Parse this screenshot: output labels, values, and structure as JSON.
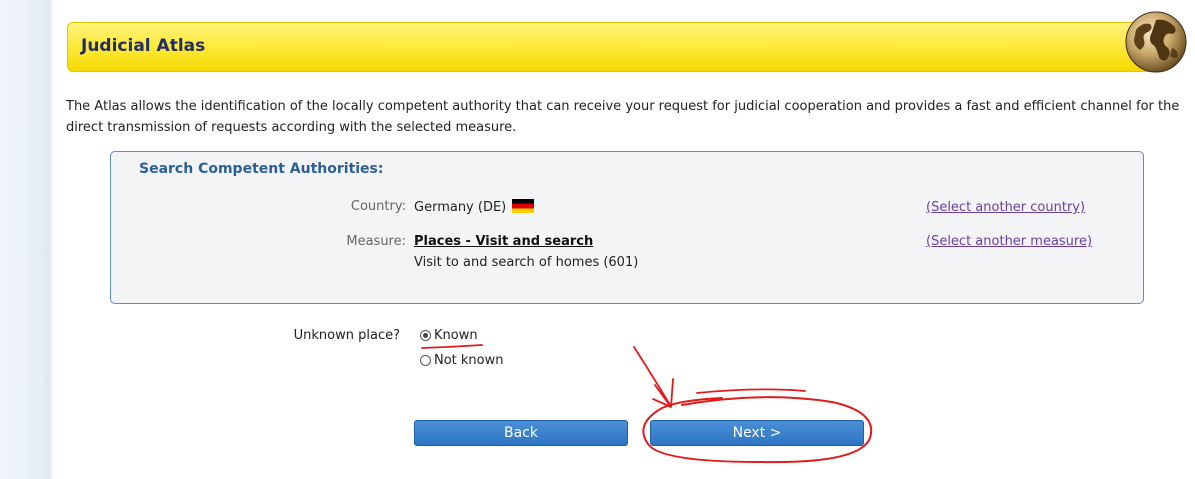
{
  "header": {
    "title": "Judicial Atlas",
    "globe_icon": "globe-icon"
  },
  "intro": {
    "text": "The Atlas allows the identification of the locally competent authority that can receive your request for judicial cooperation and provides a fast and efficient channel for the direct transmission of requests according with the selected measure."
  },
  "search": {
    "title": "Search Competent Authorities:",
    "country_label": "Country:",
    "country_value": "Germany (DE)",
    "country_flag": "germany-flag-icon",
    "select_country_link": "(Select another country)",
    "measure_label": "Measure:",
    "measure_value": "Places - Visit and search",
    "measure_detail": "Visit to and search of homes (601)",
    "select_measure_link": "(Select another measure)"
  },
  "place": {
    "label": "Unknown place?",
    "options": [
      {
        "label": "Known",
        "selected": true
      },
      {
        "label": "Not known",
        "selected": false
      }
    ]
  },
  "buttons": {
    "back": "Back",
    "next": "Next >"
  },
  "colors": {
    "header_yellow": "#ffe93a",
    "header_title": "#1f2f6b",
    "box_border": "#5b8ec2",
    "box_title": "#2c5f97",
    "link": "#6a3fa0",
    "button": "#2e75c4",
    "annotation": "#e11b1b"
  }
}
